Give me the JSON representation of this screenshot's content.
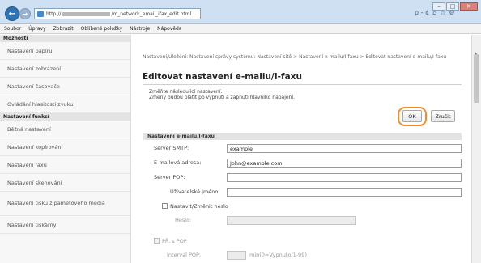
{
  "browser": {
    "address": "http://",
    "address_tail": "/m_network_email_ifax_edit.html",
    "address_tools": "ρ - ¢",
    "window_controls": [
      "–",
      "□",
      "✕"
    ]
  },
  "menu": [
    "Soubor",
    "Úpravy",
    "Zobrazit",
    "Oblíbené položky",
    "Nástroje",
    "Nápověda"
  ],
  "sidebar": {
    "section1": "Možnosti",
    "items1": [
      "Nastavení papíru",
      "Nastavení zobrazení",
      "Nastavení časovače",
      "Ovládání hlasitosti zvuku"
    ],
    "section2": "Nastavení funkcí",
    "items2": [
      "Běžná nastavení",
      "Nastavení kopírování",
      "Nastavení faxu",
      "Nastavení skenování",
      "Nastavení tisku z paměťového média",
      "Nastavení tiskárny"
    ]
  },
  "content": {
    "breadcrumb": "Nastavení/Uložení: Nastavení správy systému: Nastavení sítě > Nastavení e-mailu/I-faxu > Editovat nastavení e-mailu/I-faxu",
    "title": "Editovat nastavení e-mailu/I-faxu",
    "note1": "Změňte následující nastavení.",
    "note2": "Změny budou platit po vypnutí a zapnutí hlavního napájení.",
    "ok_label": "OK",
    "cancel_label": "Zrušit",
    "section_title": "Nastavení e-mailu/I-faxu",
    "smtp_label": "Server SMTP:",
    "smtp_value": "example",
    "email_label": "E-mailová adresa:",
    "email_value": "John@example.com",
    "pop_label": "Server POP:",
    "pop_value": "",
    "user_label": "Uživatelské jméno:",
    "user_value": "",
    "setpw_label": "Nastavit/Změnit heslo",
    "pw_label": "Heslo:",
    "pbs_label": "PŘ. s POP",
    "interval_label": "Interval POP:",
    "interval_value": "",
    "interval_unit": "min(0=Vypnuto/1-99)"
  },
  "colors": {
    "highlight_ring": "#f28c28"
  }
}
